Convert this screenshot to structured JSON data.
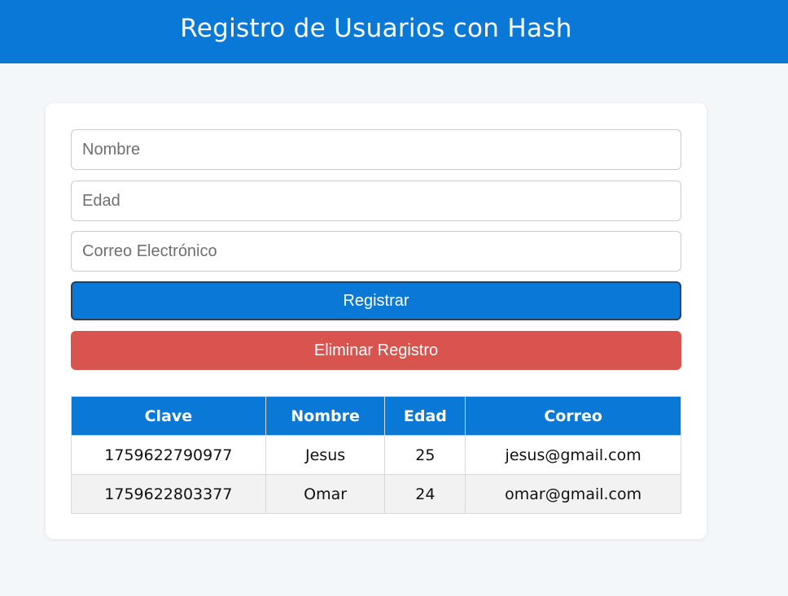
{
  "header": {
    "title": "Registro de Usuarios con Hash"
  },
  "form": {
    "nombre_placeholder": "Nombre",
    "edad_placeholder": "Edad",
    "correo_placeholder": "Correo Electrónico",
    "register_label": "Registrar",
    "delete_label": "Eliminar Registro"
  },
  "table": {
    "headers": [
      "Clave",
      "Nombre",
      "Edad",
      "Correo"
    ],
    "rows": [
      [
        "1759622790977",
        "Jesus",
        "25",
        "jesus@gmail.com"
      ],
      [
        "1759622803377",
        "Omar",
        "24",
        "omar@gmail.com"
      ]
    ]
  },
  "colors": {
    "primary": "#0a78d7",
    "danger": "#d9534f",
    "background": "#f4f7fa"
  }
}
